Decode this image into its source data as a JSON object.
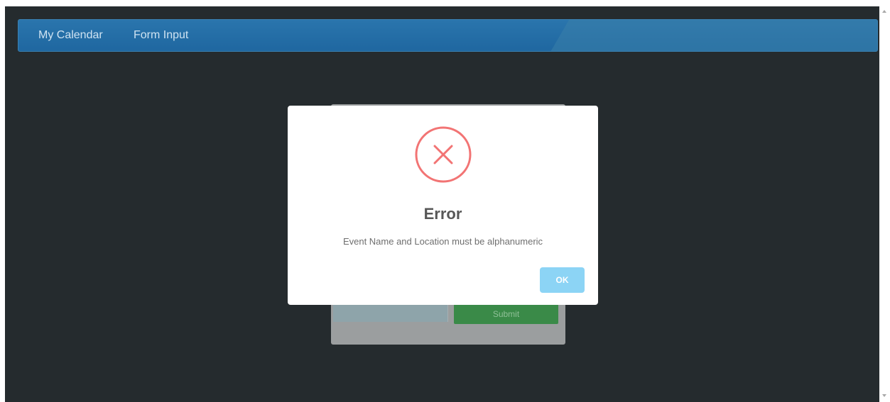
{
  "navbar": {
    "items": [
      {
        "label": "My Calendar"
      },
      {
        "label": "Form Input"
      }
    ]
  },
  "background_form": {
    "submit_label": "Submit"
  },
  "modal": {
    "icon": "error-x-circle-icon",
    "title": "Error",
    "message": "Event Name and Location must be alphanumeric",
    "ok_label": "OK"
  },
  "colors": {
    "page_background": "#252b2e",
    "navbar": "#1f67a0",
    "error_icon": "#f27474",
    "ok_button": "#8cd4f5",
    "submit_button": "#3a8a48"
  }
}
